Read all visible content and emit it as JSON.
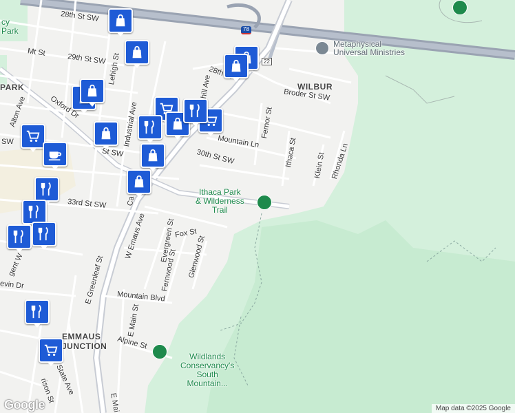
{
  "map": {
    "attribution": "Map data ©2025 Google",
    "logo": "Google",
    "areas": [
      {
        "id": "wilbur",
        "text": "WILBUR"
      },
      {
        "id": "emmaus-junction",
        "text": "EMMAUS\nJUNCTION"
      },
      {
        "id": "park-left",
        "text": "PARK"
      }
    ],
    "parks": [
      {
        "id": "ithaca-park",
        "text": "Ithaca Park\n& Wilderness\nTrail"
      },
      {
        "id": "wildlands",
        "text": "Wildlands\nConservancy's\nSouth\nMountain..."
      },
      {
        "id": "cy-park",
        "text": "cy\nPark"
      }
    ],
    "pois": [
      {
        "id": "metaphysical",
        "text": "Metaphysical\nUniversal Ministries"
      }
    ],
    "highway_shields": [
      {
        "id": "i78",
        "text": "78"
      },
      {
        "id": "r22",
        "text": "22"
      }
    ],
    "streets": [
      {
        "id": "28th-st-sw",
        "text": "28th St SW"
      },
      {
        "id": "mt-st",
        "text": "Mt St"
      },
      {
        "id": "29th-st-sw",
        "text": "29th St SW"
      },
      {
        "id": "lehigh-st",
        "text": "Lehigh St"
      },
      {
        "id": "28th-st-n",
        "text": "28th St"
      },
      {
        "id": "hill-ave",
        "text": "hill Ave"
      },
      {
        "id": "broder-st-sw",
        "text": "Broder St SW"
      },
      {
        "id": "fernor-st",
        "text": "Fernor St"
      },
      {
        "id": "oxford-dr",
        "text": "Oxford Dr"
      },
      {
        "id": "alton-ave",
        "text": "Alton Ave"
      },
      {
        "id": "industrial-ave",
        "text": "Industrial Ave"
      },
      {
        "id": "mountain-ln",
        "text": "Mountain Ln"
      },
      {
        "id": "ithaca-st",
        "text": "Ithaca St"
      },
      {
        "id": "klein-st",
        "text": "Klein St"
      },
      {
        "id": "rhonda-ln",
        "text": "Rhonda Ln"
      },
      {
        "id": "sw-left",
        "text": "SW"
      },
      {
        "id": "st-sw",
        "text": "St SW"
      },
      {
        "id": "30th-st-sw",
        "text": "30th St SW"
      },
      {
        "id": "33rd-st-sw",
        "text": "33rd St SW"
      },
      {
        "id": "ca",
        "text": "Ca"
      },
      {
        "id": "w-emaus-ave",
        "text": "W Emaus Ave"
      },
      {
        "id": "evergreen-st",
        "text": "Evergreen St"
      },
      {
        "id": "fox-st",
        "text": "Fox St"
      },
      {
        "id": "gent-w",
        "text": "gent W"
      },
      {
        "id": "glenwood-st",
        "text": "Glenwood St"
      },
      {
        "id": "fernwood-st",
        "text": "Fernwood St"
      },
      {
        "id": "e-greenleaf-st",
        "text": "E Greenleaf St"
      },
      {
        "id": "evin-dr",
        "text": "evin Dr"
      },
      {
        "id": "mountain-blvd",
        "text": "Mountain Blvd"
      },
      {
        "id": "e-main-st",
        "text": "E Main St"
      },
      {
        "id": "alpine-st",
        "text": "Alpine St"
      },
      {
        "id": "rison-st",
        "text": "rison St"
      },
      {
        "id": "state-ave",
        "text": "State Ave"
      },
      {
        "id": "e-mai",
        "text": "E Mai"
      }
    ],
    "markers": [
      {
        "id": "m1",
        "type": "shopping"
      },
      {
        "id": "m2",
        "type": "shopping"
      },
      {
        "id": "m3",
        "type": "shopping"
      },
      {
        "id": "m4",
        "type": "shopping"
      },
      {
        "id": "m5",
        "type": "shopping"
      },
      {
        "id": "m6",
        "type": "shopping"
      },
      {
        "id": "m7",
        "type": "grocery"
      },
      {
        "id": "m8",
        "type": "restaurant"
      },
      {
        "id": "m9",
        "type": "shopping"
      },
      {
        "id": "m10",
        "type": "grocery"
      },
      {
        "id": "m11",
        "type": "restaurant"
      },
      {
        "id": "m12",
        "type": "shopping"
      },
      {
        "id": "m13",
        "type": "grocery"
      },
      {
        "id": "m14",
        "type": "cafe"
      },
      {
        "id": "m15",
        "type": "shopping"
      },
      {
        "id": "m16",
        "type": "shopping"
      },
      {
        "id": "m17",
        "type": "restaurant"
      },
      {
        "id": "m18",
        "type": "restaurant"
      },
      {
        "id": "m19",
        "type": "restaurant"
      },
      {
        "id": "m20",
        "type": "restaurant"
      },
      {
        "id": "m21",
        "type": "restaurant"
      },
      {
        "id": "m22",
        "type": "grocery"
      }
    ],
    "colors": {
      "background": "#f2f2f0",
      "park": "#d4f0dc",
      "park_dark": "#c2e8cc",
      "road": "#ffffff",
      "highway": "#9aa3b2",
      "marker": "#1e5bd6",
      "park_label": "#1e8a4c"
    }
  }
}
